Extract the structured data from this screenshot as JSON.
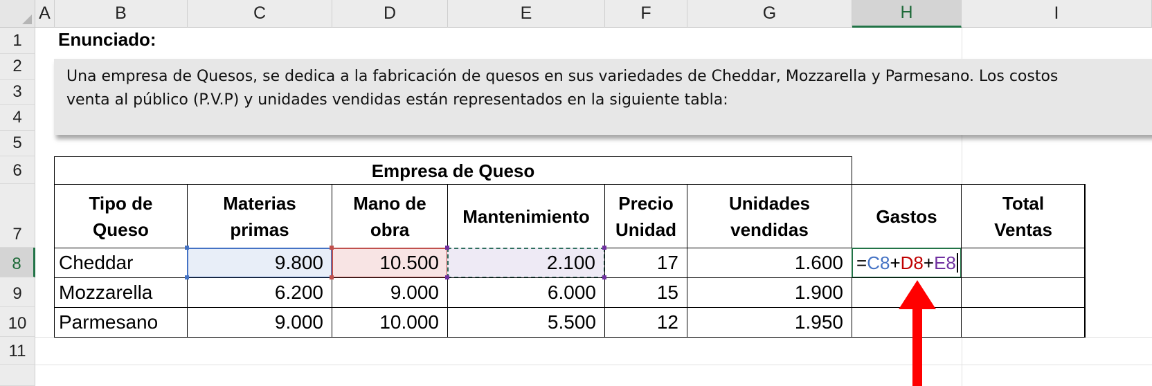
{
  "columns": [
    "A",
    "B",
    "C",
    "D",
    "E",
    "F",
    "G",
    "H",
    "I"
  ],
  "rows": [
    "1",
    "2",
    "3",
    "4",
    "5",
    "6",
    "7",
    "8",
    "9",
    "10",
    "11"
  ],
  "selected_column": "H",
  "selected_row": "8",
  "statement": {
    "title": "Enunciado:",
    "line1": "Una empresa de Quesos, se dedica a la fabricación de quesos en sus variedades de Cheddar, Mozzarella y Parmesano. Los costos",
    "line2": "venta al público (P.V.P) y unidades vendidas están representados en la siguiente tabla:"
  },
  "table": {
    "title": "Empresa de Queso",
    "headers": [
      "Tipo de Queso",
      "Materias primas",
      "Mano de obra",
      "Mantenimiento",
      "Precio Unidad",
      "Unidades vendidas",
      "Gastos",
      "Total Ventas"
    ],
    "rows": [
      [
        "Cheddar",
        "9.800",
        "10.500",
        "2.100",
        "17",
        "1.600"
      ],
      [
        "Mozzarella",
        "6.200",
        "9.000",
        "6.000",
        "15",
        "1.900"
      ],
      [
        "Parmesano",
        "9.000",
        "10.000",
        "5.500",
        "12",
        "1.950"
      ]
    ]
  },
  "formula": {
    "eq": "=",
    "c": "C8",
    "plus1": "+",
    "d": "D8",
    "plus2": "+",
    "e": "E8"
  },
  "colors": {
    "arrow": "#ff0000",
    "ref_c": "#4472c4",
    "ref_d": "#c00000",
    "ref_e": "#7030a0",
    "selection": "#217346"
  }
}
